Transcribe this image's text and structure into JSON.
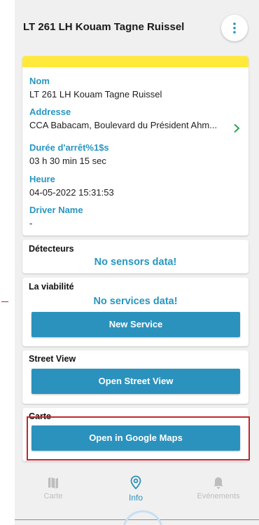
{
  "header": {
    "title": "LT 261 LH Kouam Tagne Ruissel"
  },
  "info": {
    "fields": [
      {
        "label": "Nom",
        "value": "LT 261 LH Kouam Tagne Ruissel"
      },
      {
        "label": "Addresse",
        "value": "CCA Babacam, Boulevard du Président Ahm..."
      },
      {
        "label": "Durée d'arrêt%1$s",
        "value": "03 h 30 min 15 sec"
      },
      {
        "label": "Heure",
        "value": "04-05-2022 15:31:53"
      },
      {
        "label": "Driver Name",
        "value": "-"
      }
    ]
  },
  "sensors": {
    "title": "Détecteurs",
    "message": "No sensors data!"
  },
  "services": {
    "title": "La viabilité",
    "message": "No services data!",
    "button": "New Service"
  },
  "street_view": {
    "title": "Street View",
    "button": "Open Street View"
  },
  "map": {
    "title": "Carte",
    "button": "Open in Google Maps"
  },
  "nav": {
    "items": [
      {
        "label": "Carte",
        "icon": "map-icon"
      },
      {
        "label": "Info",
        "icon": "location-pin-icon",
        "active": true
      },
      {
        "label": "Evénements",
        "icon": "bell-icon"
      }
    ]
  },
  "colors": {
    "accent": "#2b92bd",
    "label": "#2896c0",
    "banner": "#ffe93b",
    "highlight": "#c1272d"
  }
}
